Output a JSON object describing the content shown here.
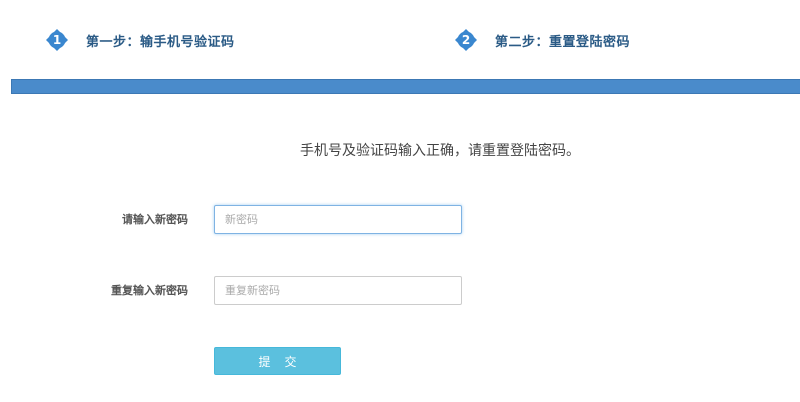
{
  "steps": [
    {
      "number": "1",
      "title": "第一步：输手机号验证码"
    },
    {
      "number": "2",
      "title": "第二步：重置登陆密码"
    }
  ],
  "colors": {
    "step_badge": "#3a87cf",
    "progress_bar": "#4a8bcb",
    "step_title": "#2b5b86",
    "submit_button": "#5bc0de"
  },
  "notice": "手机号及验证码输入正确，请重置登陆密码。",
  "form": {
    "new_password": {
      "label": "请输入新密码",
      "placeholder": "新密码",
      "value": ""
    },
    "repeat_password": {
      "label": "重复输入新密码",
      "placeholder": "重复新密码",
      "value": ""
    },
    "submit_label": "提交"
  }
}
